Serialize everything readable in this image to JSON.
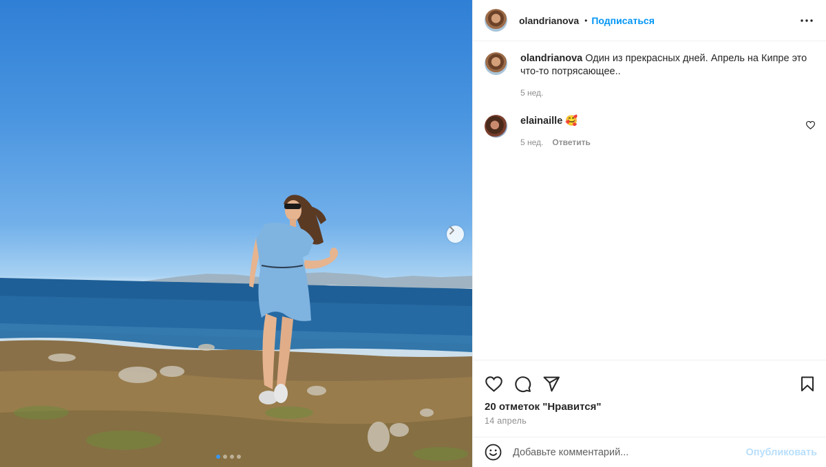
{
  "post": {
    "image_alt": "Woman in a light blue dress on a rocky coast by the sea",
    "carousel_next_icon": "chevron-right-icon",
    "carousel_dots": 4,
    "carousel_active_index": 0
  },
  "header": {
    "username": "olandrianova",
    "separator": "•",
    "follow_label": "Подписаться",
    "more_icon": "more-horizontal-icon"
  },
  "caption": {
    "username": "olandrianova",
    "text": "Один из прекрасных дней. Апрель на Кипре это что-то потрясающее..",
    "time": "5 нед."
  },
  "comments": [
    {
      "username": "elainaille",
      "text": "🥰",
      "time": "5 нед.",
      "reply_label": "Ответить",
      "like_icon": "heart-outline-icon"
    }
  ],
  "actions": {
    "like_icon": "heart-outline-icon",
    "comment_icon": "comment-icon",
    "share_icon": "paper-plane-icon",
    "save_icon": "bookmark-icon"
  },
  "likes_text": "20 отметок \"Нравится\"",
  "date_text": "14 апрель",
  "add_comment": {
    "emoji_icon": "smiley-icon",
    "placeholder": "Добавьте комментарий...",
    "publish_label": "Опубликовать"
  },
  "colors": {
    "accent": "#0095f6",
    "publish_disabled": "#b9dffc",
    "muted": "#8e8e8e",
    "text": "#262626"
  }
}
